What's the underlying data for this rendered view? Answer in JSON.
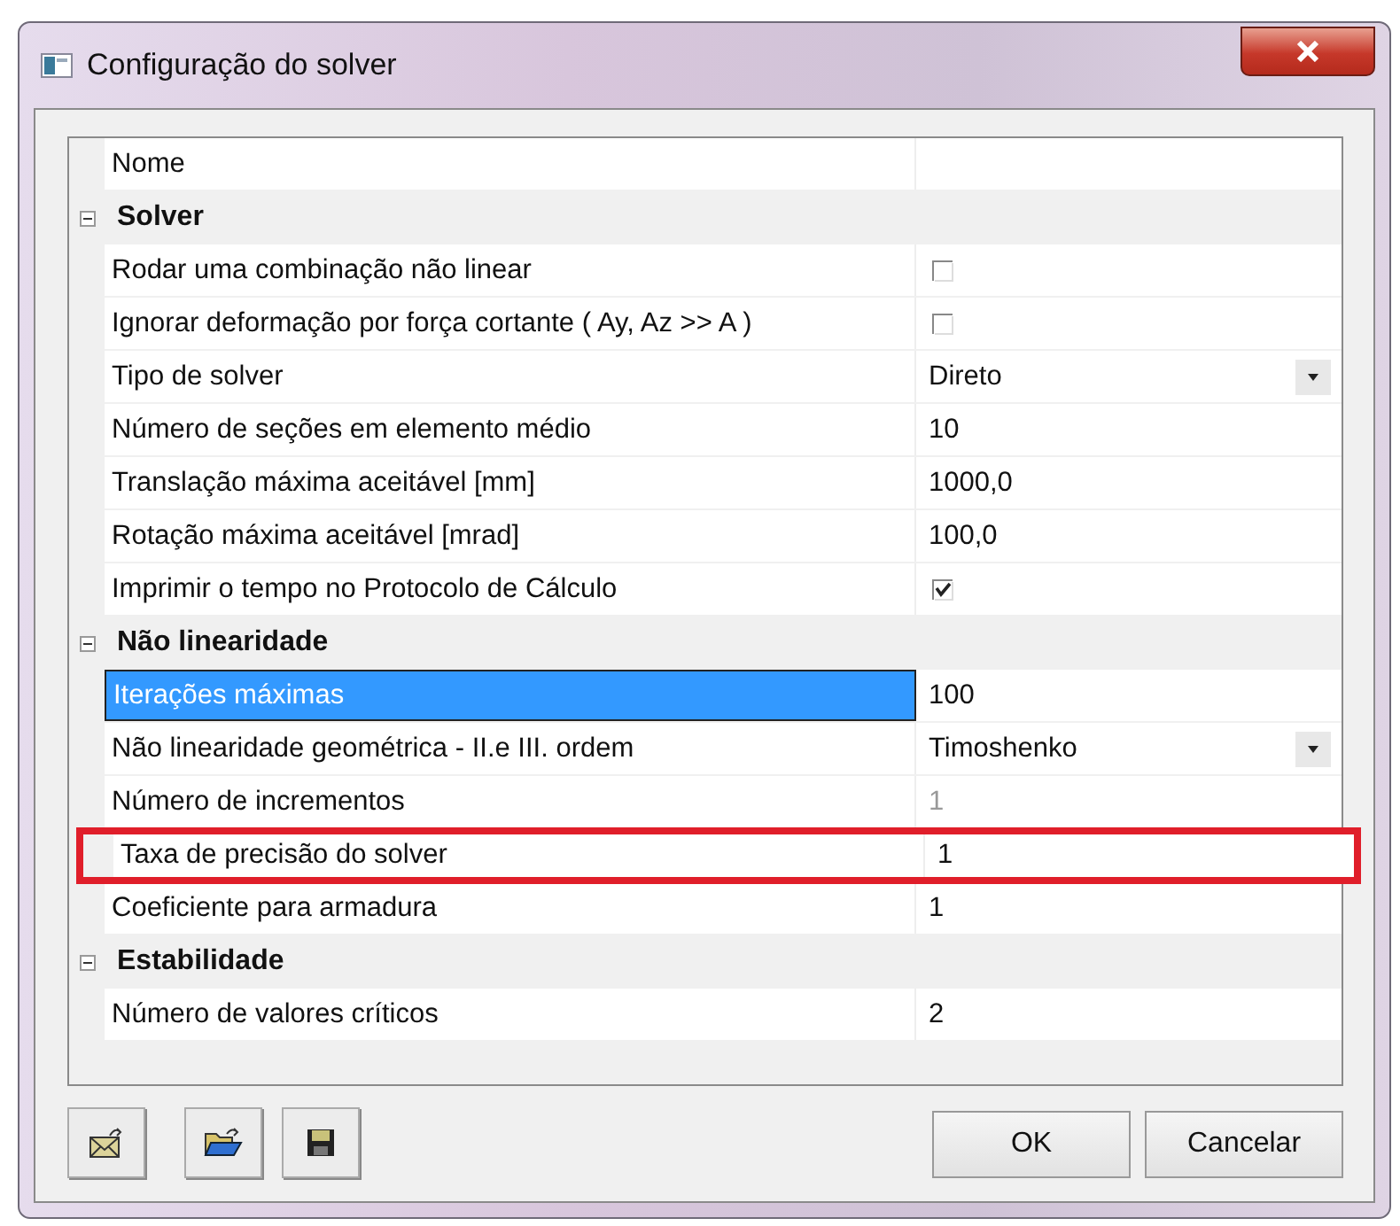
{
  "window": {
    "title": "Configuração do solver"
  },
  "grid": {
    "rows": [
      {
        "kind": "text",
        "label": "Nome",
        "value": "",
        "selected": false,
        "outlined": false
      },
      {
        "kind": "category",
        "label": "Solver",
        "expanded": true,
        "children": [
          {
            "kind": "checkbox",
            "label": "Rodar uma combinação não linear",
            "checked": false,
            "selected": false,
            "disabled": false,
            "outlined": false
          },
          {
            "kind": "checkbox",
            "label": "Ignorar deformação por força cortante ( Ay, Az >> A )",
            "checked": false,
            "selected": false,
            "disabled": false,
            "outlined": false
          },
          {
            "kind": "dropdown",
            "label": "Tipo de solver",
            "value": "Direto",
            "selected": false,
            "disabled": false,
            "outlined": false
          },
          {
            "kind": "text",
            "label": "Número de seções em elemento médio",
            "value": "10",
            "selected": false,
            "disabled": false,
            "outlined": false
          },
          {
            "kind": "text",
            "label": "Translação máxima aceitável [mm]",
            "value": "1000,0",
            "selected": false,
            "disabled": false,
            "outlined": false
          },
          {
            "kind": "text",
            "label": "Rotação máxima aceitável [mrad]",
            "value": "100,0",
            "selected": false,
            "disabled": false,
            "outlined": false
          },
          {
            "kind": "checkbox",
            "label": "Imprimir o tempo no Protocolo de Cálculo",
            "checked": true,
            "selected": false,
            "disabled": false,
            "outlined": false
          }
        ]
      },
      {
        "kind": "category",
        "label": "Não linearidade",
        "expanded": true,
        "children": [
          {
            "kind": "text",
            "label": "Iterações máximas",
            "value": "100",
            "selected": true,
            "disabled": false,
            "outlined": false
          },
          {
            "kind": "dropdown",
            "label": "Não linearidade geométrica - II.e III. ordem",
            "value": "Timoshenko",
            "selected": false,
            "disabled": false,
            "outlined": false
          },
          {
            "kind": "text",
            "label": "Número de incrementos",
            "value": "1",
            "selected": false,
            "disabled": true,
            "outlined": false
          },
          {
            "kind": "text",
            "label": "Taxa de precisão do solver",
            "value": "1",
            "selected": false,
            "disabled": false,
            "outlined": true
          },
          {
            "kind": "text",
            "label": "Coeficiente para armadura",
            "value": "1",
            "selected": false,
            "disabled": false,
            "outlined": false
          }
        ]
      },
      {
        "kind": "category",
        "label": "Estabilidade",
        "expanded": true,
        "children": [
          {
            "kind": "text",
            "label": "Número de valores críticos",
            "value": "2",
            "selected": false,
            "disabled": false,
            "outlined": false
          }
        ]
      }
    ]
  },
  "buttons": [
    "OK",
    "Cancelar"
  ]
}
